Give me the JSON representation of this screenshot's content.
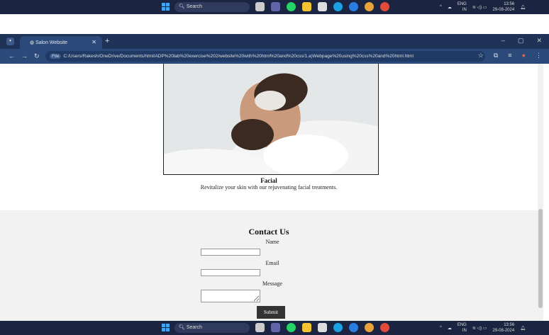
{
  "taskbar": {
    "search_label": "Search",
    "lang": "ENG",
    "region": "IN",
    "time": "13:56",
    "date": "29-08-2024",
    "apps": [
      "file-explorer-icon",
      "teams-icon",
      "whatsapp-icon",
      "folder-icon",
      "store-icon",
      "edge-icon",
      "help-icon",
      "chrome-icon",
      "chrome-canary-icon"
    ]
  },
  "browser": {
    "tab_title": "Salon Website",
    "url_chip": "File",
    "url": "C:/Users/Rakesh/OneDrive/Documents/html/ADP%20lab%20exercise%202/website%20with%20html%20and%20css/1.a)Webpage%20using%20css%20and%20html.html"
  },
  "service": {
    "title": "Facial",
    "description": "Revitalize your skin with our rejuvenating facial treatments."
  },
  "contact": {
    "heading": "Contact Us",
    "name_label": "Name",
    "email_label": "Email",
    "message_label": "Message",
    "name_value": "",
    "email_value": "",
    "message_value": "",
    "submit_label": "Submit"
  },
  "colors": {
    "taskbar": "#1b2440",
    "titlebar": "#1f3358",
    "addressbar": "#2b4a7a",
    "contact_bg": "#f2f2f2",
    "button": "#333333"
  }
}
